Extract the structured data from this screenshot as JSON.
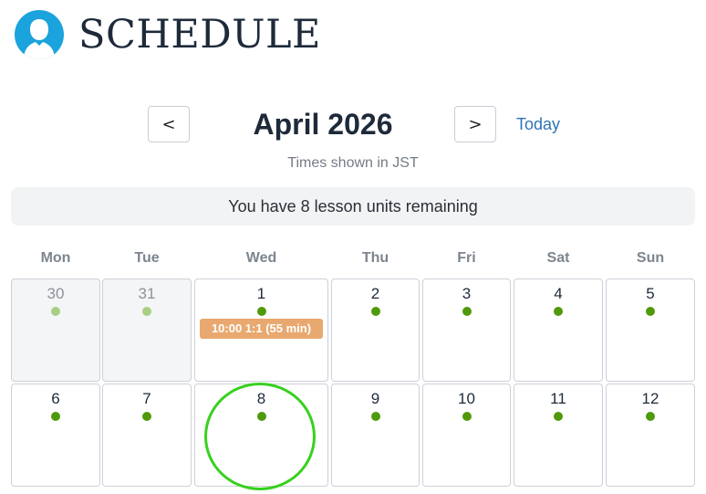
{
  "header": {
    "title": "SCHEDULE"
  },
  "nav": {
    "prev_label": "<",
    "next_label": ">",
    "month_title": "April 2026",
    "today_label": "Today"
  },
  "timezone_note": "Times shown in JST",
  "units_banner": "You have 8 lesson units remaining",
  "weekdays": [
    "Mon",
    "Tue",
    "Wed",
    "Thu",
    "Fri",
    "Sat",
    "Sun"
  ],
  "weeks": [
    [
      {
        "day": "30",
        "other_month": true,
        "available": true
      },
      {
        "day": "31",
        "other_month": true,
        "available": true
      },
      {
        "day": "1",
        "other_month": false,
        "available": true,
        "lesson": "10:00 1:1 (55 min)"
      },
      {
        "day": "2",
        "other_month": false,
        "available": true
      },
      {
        "day": "3",
        "other_month": false,
        "available": true
      },
      {
        "day": "4",
        "other_month": false,
        "available": true
      },
      {
        "day": "5",
        "other_month": false,
        "available": true
      }
    ],
    [
      {
        "day": "6",
        "other_month": false,
        "available": true
      },
      {
        "day": "7",
        "other_month": false,
        "available": true
      },
      {
        "day": "8",
        "other_month": false,
        "available": true,
        "highlighted": true
      },
      {
        "day": "9",
        "other_month": false,
        "available": true
      },
      {
        "day": "10",
        "other_month": false,
        "available": true
      },
      {
        "day": "11",
        "other_month": false,
        "available": true
      },
      {
        "day": "12",
        "other_month": false,
        "available": true
      }
    ]
  ],
  "colors": {
    "avatar": "#1aa3dc",
    "available_dot": "#4f9a0b",
    "lesson_badge": "#e8a86f",
    "highlight_ring": "#38d11e",
    "link": "#2e74b5"
  }
}
